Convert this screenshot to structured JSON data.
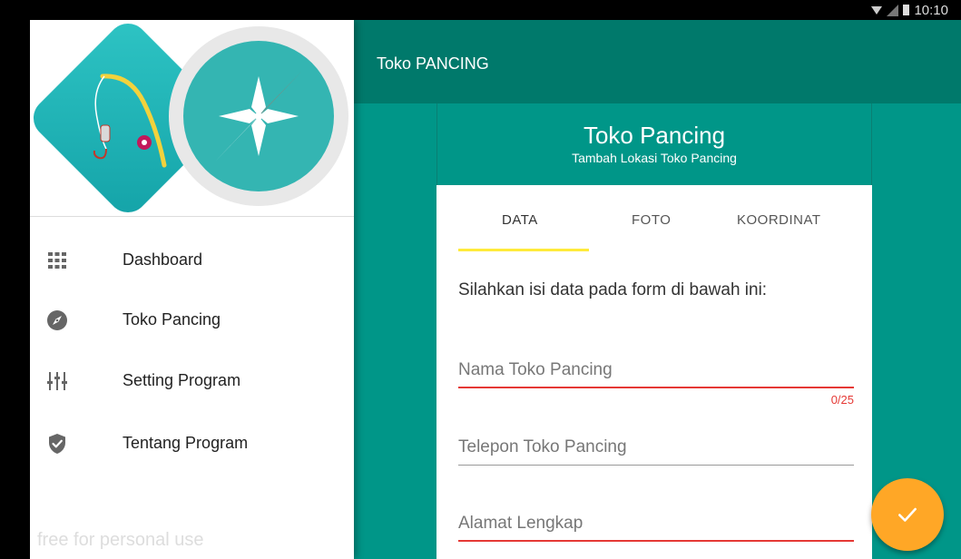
{
  "status_bar": {
    "time": "10:10"
  },
  "app_bar": {
    "title": "Toko PANCING"
  },
  "card": {
    "title": "Toko Pancing",
    "subtitle": "Tambah Lokasi Toko Pancing",
    "tabs": [
      {
        "label": "DATA",
        "active": true
      },
      {
        "label": "FOTO",
        "active": false
      },
      {
        "label": "KOORDINAT",
        "active": false
      }
    ],
    "instruction": "Silahkan isi data pada form di bawah ini:",
    "fields": {
      "nama": {
        "label": "Nama Toko Pancing",
        "counter": "0/25"
      },
      "telepon": {
        "label": "Telepon Toko Pancing"
      },
      "alamat": {
        "label": "Alamat Lengkap"
      }
    }
  },
  "drawer": {
    "items": [
      {
        "label": "Dashboard",
        "icon": "grid-icon"
      },
      {
        "label": "Toko Pancing",
        "icon": "compass-icon"
      },
      {
        "label": "Setting Program",
        "icon": "sliders-icon"
      },
      {
        "label": "Tentang Program",
        "icon": "shield-check-icon"
      }
    ],
    "watermark": "free for personal use"
  },
  "fab": {
    "icon": "check-icon"
  },
  "colors": {
    "primary_dark": "#00796b",
    "primary": "#009688",
    "accent": "#ffa726",
    "tab_indicator": "#ffeb3b",
    "error": "#e53935"
  }
}
